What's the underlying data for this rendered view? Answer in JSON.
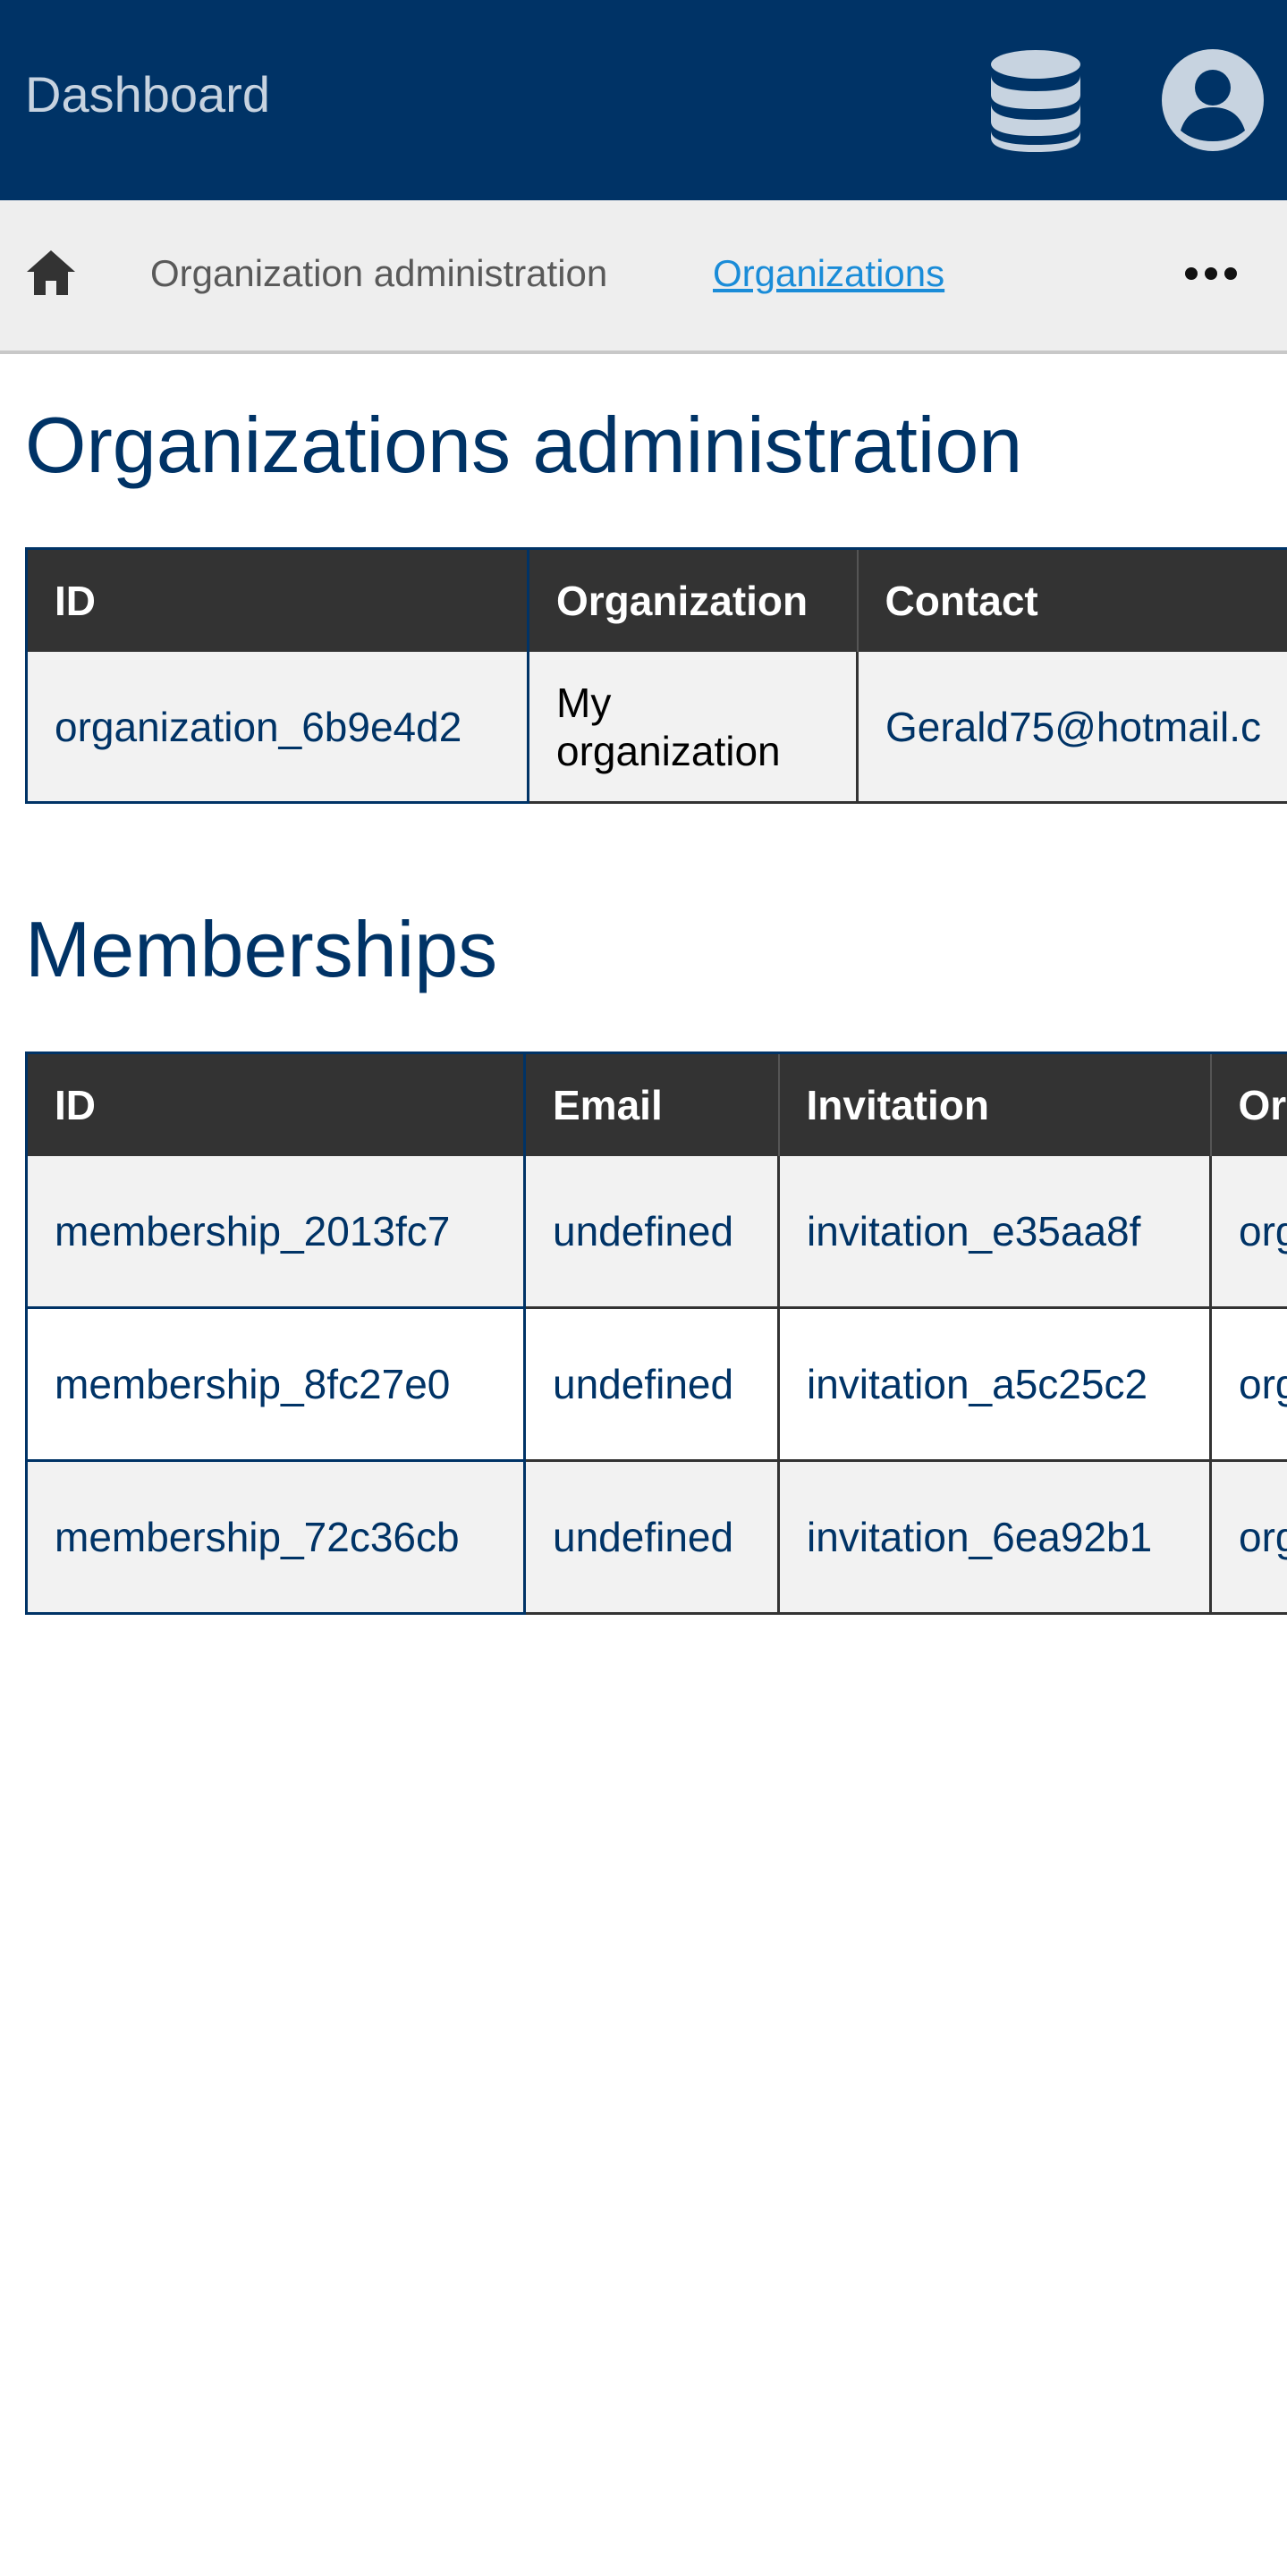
{
  "header": {
    "brand": "Dashboard",
    "database_icon": "database-icon",
    "account_icon": "user-circle-icon",
    "background_color": "#003366"
  },
  "breadcrumb": {
    "home_icon": "home-icon",
    "items": [
      {
        "label": "Organization administration"
      },
      {
        "label": "Organizations"
      }
    ],
    "more_icon": "ellipsis-icon",
    "link_color": "#1a8cd8"
  },
  "organizations": {
    "title": "Organizations administration",
    "columns": [
      "ID",
      "Organization",
      "Contact"
    ],
    "rows": [
      {
        "id": "organization_6b9e4d2",
        "organization": "My organization",
        "contact": "Gerald75@hotmail.c"
      }
    ]
  },
  "memberships": {
    "title": "Memberships",
    "columns": [
      "ID",
      "Email",
      "Invitation",
      "Or"
    ],
    "rows": [
      {
        "id": "membership_2013fc7",
        "email": "undefined",
        "invitation": "invitation_e35aa8f",
        "organization": "org"
      },
      {
        "id": "membership_8fc27e0",
        "email": "undefined",
        "invitation": "invitation_a5c25c2",
        "organization": "org"
      },
      {
        "id": "membership_72c36cb",
        "email": "undefined",
        "invitation": "invitation_6ea92b1",
        "organization": "org"
      }
    ]
  }
}
